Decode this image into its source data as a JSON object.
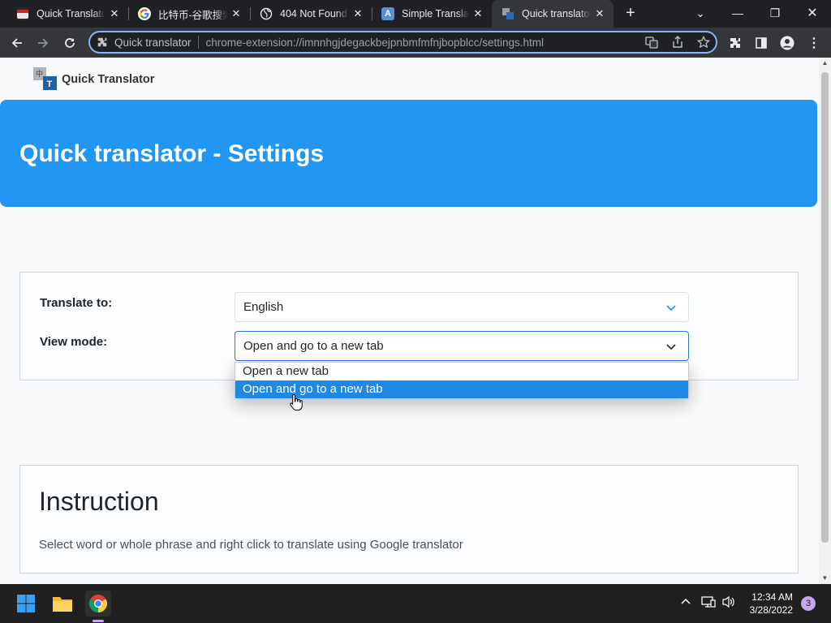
{
  "browser": {
    "tabs": [
      {
        "title": "Quick Translator",
        "icon": "quick-translator-favicon",
        "active": false
      },
      {
        "title": "比特币-谷歌搜索",
        "icon": "google-g-icon",
        "active": false
      },
      {
        "title": "404 Not Found",
        "icon": "globe-icon",
        "active": false
      },
      {
        "title": "Simple Translate",
        "icon": "translate-favicon",
        "active": false
      },
      {
        "title": "Quick translator",
        "icon": "quick-translator-favicon",
        "active": true
      }
    ],
    "omnibox": {
      "chip_label": "Quick translator",
      "url": "chrome-extension://imnnhgjdegackbejpnbmfmfnjbopblcc/settings.html"
    }
  },
  "page": {
    "brand": "Quick Translator",
    "hero_title": "Quick translator - Settings",
    "settings": {
      "translate_to_label": "Translate to:",
      "translate_to_value": "English",
      "view_mode_label": "View mode:",
      "view_mode_value": "Open and go to a new tab",
      "view_mode_options": [
        "Open a new tab",
        "Open and go to a new tab"
      ]
    },
    "instruction": {
      "heading": "Instruction",
      "text": "Select word or whole phrase and right click to translate using Google translator"
    }
  },
  "taskbar": {
    "time": "12:34 AM",
    "date": "3/28/2022",
    "notification_count": "3"
  },
  "colors": {
    "hero": "#2196f3",
    "selected_option": "#1e88e5",
    "focus_border": "#2b78d6",
    "omnibox_focus": "#8ab4f8"
  }
}
